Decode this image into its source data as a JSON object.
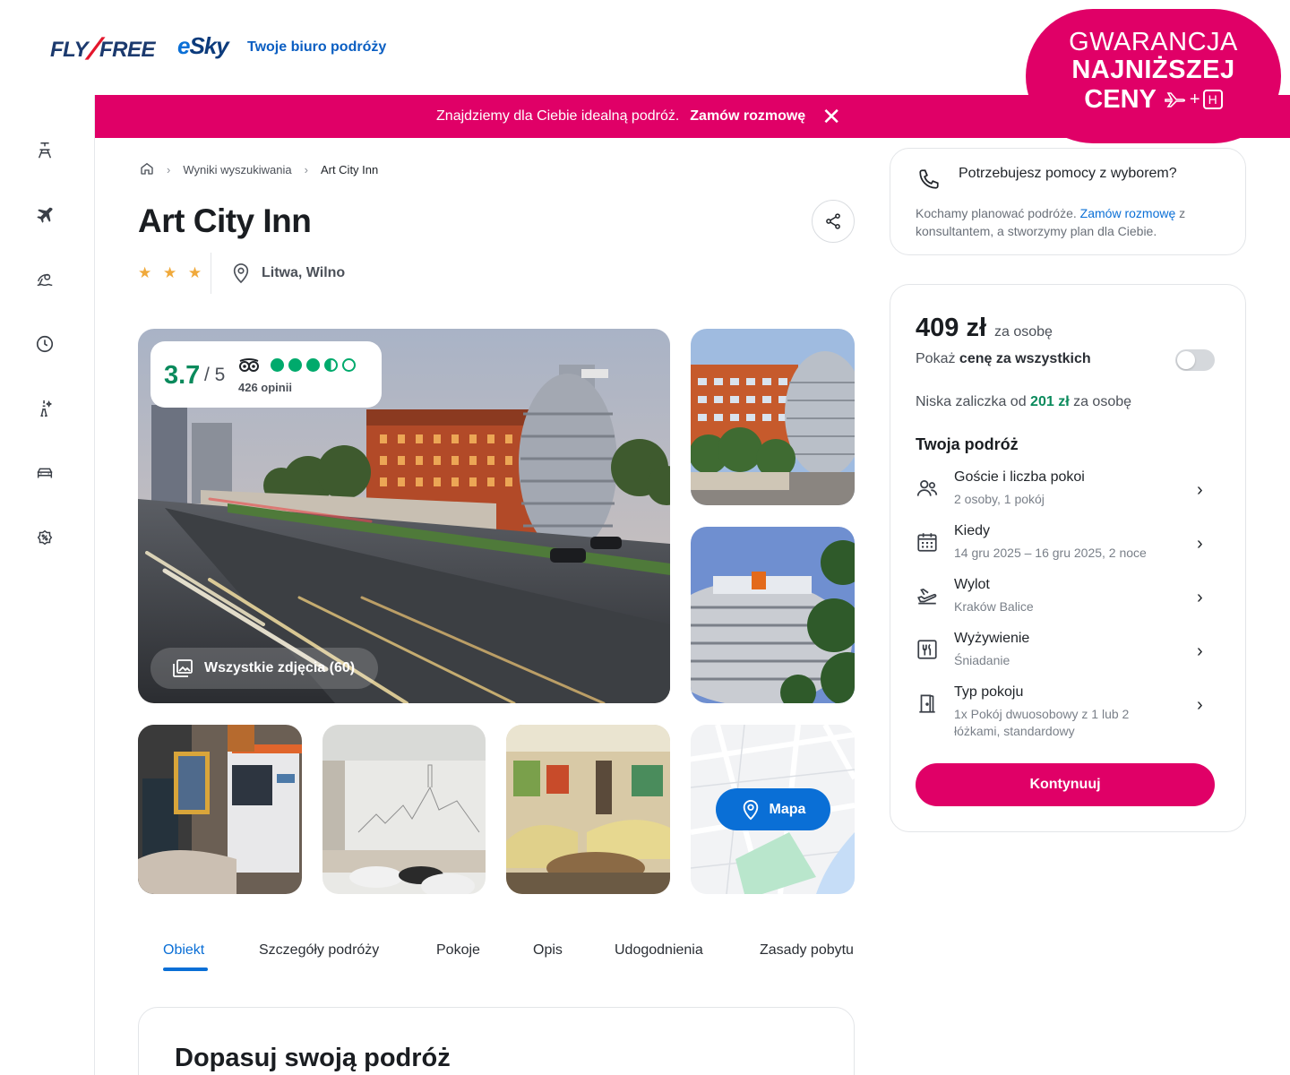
{
  "header": {
    "logo_fly": "FLY",
    "logo_free": "FREE",
    "logo_esky": "Sky",
    "logo_esky_e": "e",
    "tagline": "Twoje biuro podróży"
  },
  "guarantee": {
    "line1": "GWARANCJA",
    "line2": "NAJNIŻSZEJ",
    "line3": "CENY",
    "plus": "+",
    "hotel_letter": "H"
  },
  "banner": {
    "text": "Znajdziemy dla Ciebie idealną podróż.",
    "link": "Zamów rozmowę",
    "close": "✕"
  },
  "sidenav": {
    "icons": [
      "beach-chair-icon",
      "plane-icon",
      "sun-beach-icon",
      "clock-icon",
      "eiffel-tower-icon",
      "car-icon",
      "discount-badge-icon"
    ]
  },
  "breadcrumb": {
    "home_icon": "home-icon",
    "sep": "›",
    "search_results": "Wyniki wyszukiwania",
    "current": "Art City Inn"
  },
  "hotel": {
    "name": "Art City Inn",
    "stars": "★ ★ ★",
    "star_count": 3,
    "location": "Litwa, Wilno"
  },
  "rating": {
    "score": "3.7",
    "max": "/ 5",
    "dots": 3.5,
    "reviews": "426 opinii"
  },
  "gallery": {
    "all_photos": "Wszystkie zdjęcia (60)",
    "map_button": "Mapa"
  },
  "tabs": [
    {
      "label": "Obiekt"
    },
    {
      "label": "Szczegóły podróży"
    },
    {
      "label": "Pokoje"
    },
    {
      "label": "Opis"
    },
    {
      "label": "Udogodnienia"
    },
    {
      "label": "Zasady pobytu"
    }
  ],
  "adjust": {
    "title": "Dopasuj swoją podróż"
  },
  "help": {
    "title": "Potrzebujesz pomocy z wyborem?",
    "text_before": "Kochamy planować podróże. ",
    "link": "Zamów rozmowę",
    "text_after": " z konsultantem, a stworzymy plan dla Ciebie."
  },
  "price": {
    "amount": "409 zł",
    "per": "za osobę",
    "show_all_prefix": "Pokaż ",
    "show_all_bold": "cenę za wszystkich",
    "deposit_prefix": "Niska zaliczka od ",
    "deposit_amount": "201 zł",
    "deposit_suffix": " za osobę",
    "trip_title": "Twoja podróż",
    "rows": [
      {
        "label": "Goście i liczba pokoi",
        "value": "2 osoby, 1 pokój",
        "icon": "users-icon"
      },
      {
        "label": "Kiedy",
        "value": "14 gru 2025 – 16 gru 2025, 2 noce",
        "icon": "calendar-icon"
      },
      {
        "label": "Wylot",
        "value": "Kraków Balice",
        "icon": "plane-departure-icon"
      },
      {
        "label": "Wyżywienie",
        "value": "Śniadanie",
        "icon": "menu-cutlery-icon"
      },
      {
        "label": "Typ pokoju",
        "value": "1x Pokój dwuosobowy z 1 lub 2 łóżkami, standardowy",
        "icon": "door-icon"
      }
    ],
    "chevron": "›",
    "continue": "Kontynuuj"
  },
  "colors": {
    "brand_pink": "#e00067",
    "accent_blue": "#0a6fd6",
    "rating_green": "#0a8a5c",
    "star_gold": "#f0a93b"
  }
}
